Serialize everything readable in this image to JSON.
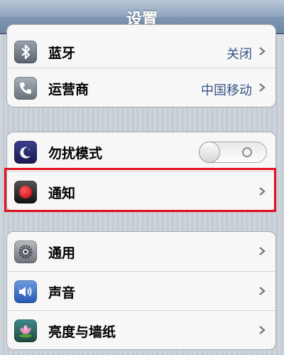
{
  "navbar": {
    "title": "设置"
  },
  "group1": {
    "rows": [
      {
        "label": "蓝牙",
        "value": "关闭",
        "icon": "bluetooth-icon"
      },
      {
        "label": "运营商",
        "value": "中国移动",
        "icon": "carrier-phone-icon"
      }
    ]
  },
  "group2": {
    "rows": [
      {
        "label": "勿扰模式",
        "icon": "moon-icon",
        "toggle_on": false
      },
      {
        "label": "通知",
        "icon": "notifications-icon"
      }
    ]
  },
  "group3": {
    "rows": [
      {
        "label": "通用",
        "icon": "gear-icon"
      },
      {
        "label": "声音",
        "icon": "speaker-icon"
      },
      {
        "label": "亮度与墙纸",
        "icon": "flower-icon"
      }
    ]
  },
  "colors": {
    "navbar": "#7f96b3",
    "value_text": "#385487",
    "highlight_box": "#e0101c"
  }
}
